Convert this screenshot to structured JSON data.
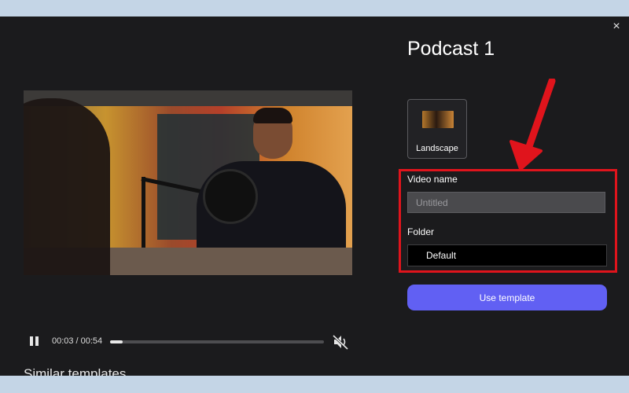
{
  "modal": {
    "close_symbol": "×",
    "title": "Podcast 1",
    "similar_heading": "Similar templates"
  },
  "player": {
    "current_time": "00:03",
    "duration": "00:54",
    "separator": "/",
    "progress_fraction": 0.06,
    "pause_icon": "pause-icon",
    "mute_icon": "speaker-muted-icon"
  },
  "formats": [
    {
      "label": "Landscape",
      "selected": true
    }
  ],
  "form": {
    "video_name_label": "Video name",
    "video_name_placeholder": "Untitled",
    "video_name_value": "",
    "folder_label": "Folder",
    "folder_value": "Default"
  },
  "actions": {
    "use_template_label": "Use template"
  },
  "colors": {
    "accent": "#6160f3",
    "highlight": "#e0141c",
    "modal_bg": "#1b1b1d",
    "page_bg": "#c4d5e6"
  }
}
